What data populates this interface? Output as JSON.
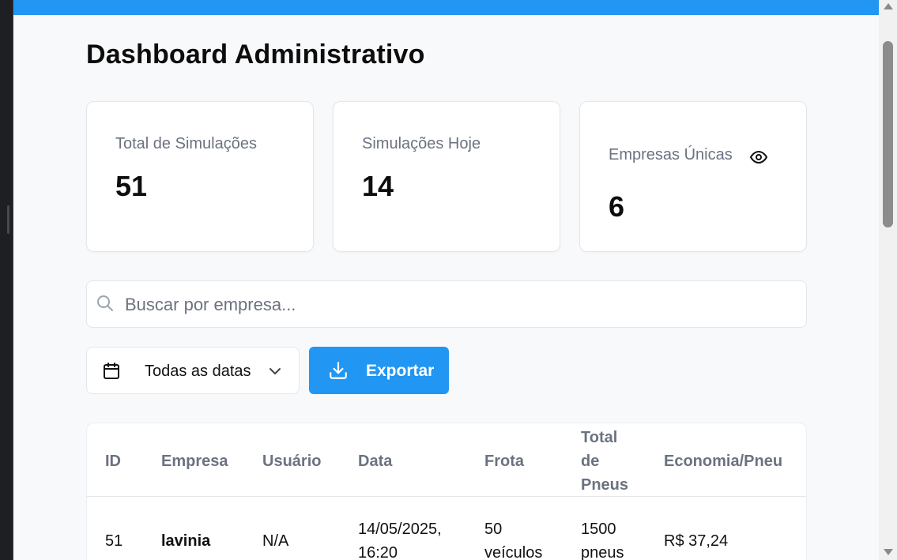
{
  "page": {
    "title": "Dashboard Administrativo"
  },
  "stats": {
    "total_label": "Total de Simulações",
    "total_value": "51",
    "today_label": "Simulações Hoje",
    "today_value": "14",
    "unique_label": "Empresas Únicas",
    "unique_value": "6",
    "unique_icon": "eye-icon"
  },
  "search": {
    "placeholder": "Buscar por empresa...",
    "value": ""
  },
  "filters": {
    "date_selected": "Todas as datas"
  },
  "actions": {
    "export_label": "Exportar"
  },
  "colors": {
    "accent": "#2196f3"
  },
  "table": {
    "headers": {
      "id": "ID",
      "empresa": "Empresa",
      "usuario": "Usuário",
      "data": "Data",
      "frota": "Frota",
      "total_pneus_1": "Total",
      "total_pneus_2": "de",
      "total_pneus_3": "Pneus",
      "economia": "Economia/Pneu"
    },
    "rows": [
      {
        "id": "51",
        "empresa": "lavinia",
        "usuario": "N/A",
        "data_line1": "14/05/2025,",
        "data_line2": "16:20",
        "frota_line1": "50",
        "frota_line2": "veículos",
        "pneus_line1": "1500",
        "pneus_line2": "pneus",
        "economia": "R$ 37,24"
      }
    ]
  }
}
